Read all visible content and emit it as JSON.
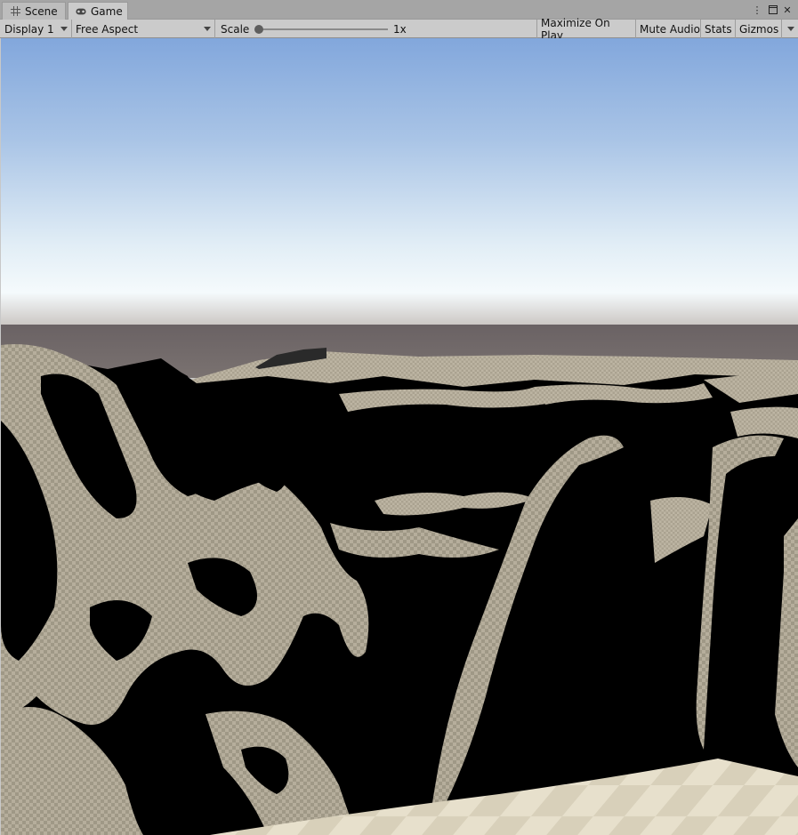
{
  "tabs": {
    "scene_label": "Scene",
    "game_label": "Game"
  },
  "toolbar": {
    "display": "Display 1",
    "aspect": "Free Aspect",
    "scale_label": "Scale",
    "scale_value": "1x",
    "scale_fraction": 0.0,
    "maximize_on_play": "Maximize On Play",
    "mute_audio": "Mute Audio",
    "stats": "Stats",
    "gizmos": "Gizmos"
  },
  "icons": {
    "scene_tab": "grid-icon",
    "game_tab": "gamepad-icon",
    "menu": "kebab-menu-icon",
    "maximize": "maximize-icon",
    "close": "close-icon"
  },
  "colors": {
    "sky_top": "#82a7dc",
    "sky_horizon": "#f4f8fb",
    "ground_far": "#6c6466",
    "terrain_light": "#b5ad9c",
    "terrain_shadow": "#000000",
    "floor": "#e6dfcb"
  }
}
